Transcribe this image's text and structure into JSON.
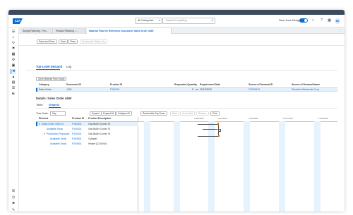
{
  "shell": {
    "logo": "SAP",
    "category": "All Categories",
    "search_placeholder": "Search Everything",
    "new_home_design": "New Home Design",
    "avatar": "BS"
  },
  "tabs": [
    {
      "label": "Supply Planning - Pro..."
    },
    {
      "label": "Product Planning -..."
    },
    {
      "label": "Material Flow for Reference Document: Sales Order 4490"
    }
  ],
  "toolbar": {
    "save_close": "Save and Close",
    "save": "Save",
    "close": "Close",
    "reschedule": "Reschedule Bottom Up"
  },
  "subtabs": {
    "top_level": "Top-Level Demand",
    "log": "Log"
  },
  "open_graph": "Open Material Flow Graph",
  "demand_table": {
    "headers": [
      "Category",
      "Document ID",
      "Product ID",
      "Requested Quantity",
      "Requirement Date",
      "Source of Demand ID",
      "Source of Demand Name"
    ],
    "row": {
      "category": "Sales Order",
      "document_id": "4490",
      "product_id": "P100401",
      "quantity": "5",
      "unit": "ea",
      "date": "11/21/2023",
      "source_id": "CP100610",
      "source_name": "Silverline Wholesale Corp."
    }
  },
  "details_title": "Details: Sales Order 4490",
  "detail_tabs": {
    "table": "Table",
    "graphic": "Graphic"
  },
  "gantt_toolbar": {
    "time_scale_label": "Time Scale:",
    "time_scale_value": "Day",
    "expand": "Expand",
    "expand_all": "Expand All",
    "collapse_all": "Collapse All",
    "reschedule_top_down": "Reschedule Top Down",
    "start": "Start",
    "undo_start": "Undo Start",
    "release": "Release",
    "print": "Print"
  },
  "gantt": {
    "headers": [
      "Element",
      "Product ID",
      "Product Description"
    ],
    "rows": [
      {
        "element": "Sales Order 4490 10",
        "product_id": "P100401",
        "desc": "Gas Boiler Combi 75"
      },
      {
        "element": "Available Stock",
        "product_id": "P100401",
        "desc": "Gas Boiler Combi 75"
      },
      {
        "element": "Production Proposals",
        "product_id": "P100401",
        "desc": "Gas Boiler Combi 75"
      },
      {
        "element": "Available Stock",
        "product_id": "P100801",
        "desc": "Cylinder"
      },
      {
        "element": "Available Stock",
        "product_id": "P100501",
        "desc": "Heater (22.8 kW)"
      }
    ],
    "dates": [
      "11/06/2023",
      "11/13/2023",
      "11/20/2023",
      "11/27/2023",
      "12/04/2023"
    ]
  }
}
